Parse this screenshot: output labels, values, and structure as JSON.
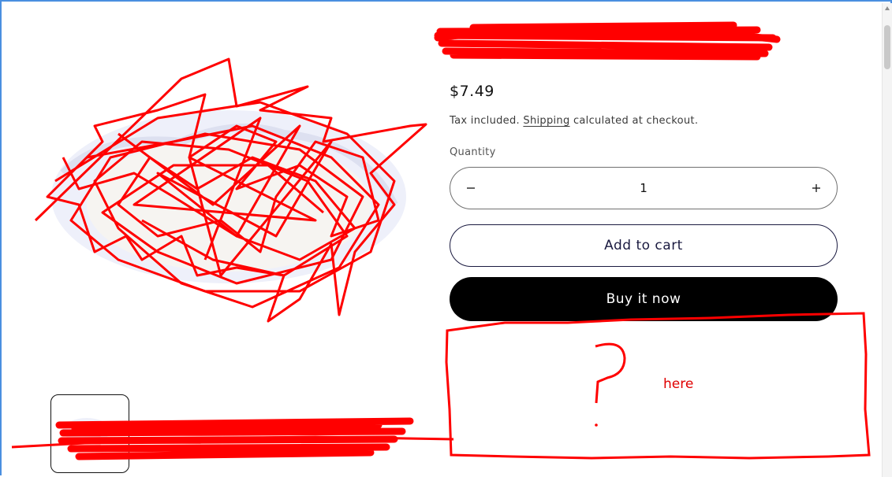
{
  "product": {
    "price": "$7.49",
    "tax_prefix": "Tax included.",
    "shipping_link": "Shipping",
    "tax_suffix": "calculated at checkout.",
    "quantity_label": "Quantity",
    "quantity_value": "1",
    "decrease_icon": "minus-icon",
    "increase_icon": "plus-icon",
    "add_to_cart": "Add to cart",
    "buy_now": "Buy it now"
  },
  "annotation": {
    "note": "here",
    "mark": "?"
  },
  "colors": {
    "frame": "#4a8fe0",
    "scribble": "#ff0000",
    "buy_button": "#000000"
  }
}
